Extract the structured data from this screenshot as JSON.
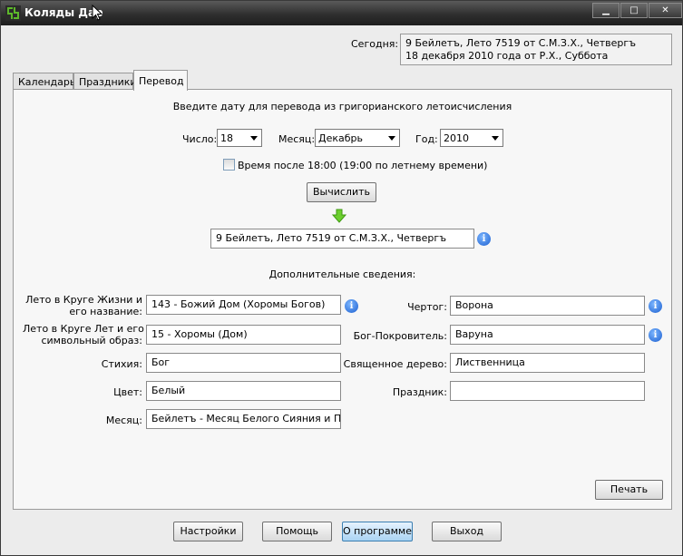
{
  "window": {
    "title": "Коляды Дар",
    "min_label": "▁",
    "max_label": "□",
    "close_label": "✕"
  },
  "today": {
    "label": "Сегодня:",
    "line1": "9 Бейлетъ, Лето 7519 от С.М.З.Х., Четвергъ",
    "line2": "18 декабря 2010 года от Р.Х., Суббота"
  },
  "tabs": [
    {
      "label": "Календарь"
    },
    {
      "label": "Праздники"
    },
    {
      "label": "Перевод",
      "active": true
    }
  ],
  "converter": {
    "instruction": "Введите дату для перевода из григорианского летоисчисления",
    "day_label": "Число:",
    "day_value": "18",
    "month_label": "Месяц:",
    "month_value": "Декабрь",
    "year_label": "Год:",
    "year_value": "2010",
    "checkbox_label": "Время после 18:00 (19:00 по летнему времени)",
    "checkbox_checked": false,
    "compute_button": "Вычислить",
    "result": "9 Бейлетъ, Лето 7519 от С.М.З.Х., Четвергъ"
  },
  "details": {
    "heading": "Дополнительные сведения:",
    "info_glyph": "i",
    "circle_of_life_label_1": "Лето в Круге Жизни и",
    "circle_of_life_label_2": "его название:",
    "circle_of_life_value": "143 - Божий Дом (Хоромы Богов)",
    "circle_of_years_label_1": "Лето в Круге Лет и его",
    "circle_of_years_label_2": "символьный образ:",
    "circle_of_years_value": "15 - Хоромы (Дом)",
    "element_label": "Стихия:",
    "element_value": "Бог",
    "color_label": "Цвет:",
    "color_value": "Белый",
    "month_label": "Месяц:",
    "month_value": "Бейлетъ - Месяц Белого Сияния и Покоя",
    "chertog_label": "Чертог:",
    "chertog_value": "Ворона",
    "patron_label": "Бог-Покровитель:",
    "patron_value": "Варуна",
    "tree_label": "Священное дерево:",
    "tree_value": "Лиственница",
    "holiday_label": "Праздник:",
    "holiday_value": ""
  },
  "print_button": "Печать",
  "footer": {
    "settings": "Настройки",
    "help": "Помощь",
    "about": "О программе",
    "exit": "Выход"
  },
  "colors": {
    "titlebar": "#2f2f2f",
    "accent_green": "#5db82a",
    "info_blue": "#1c5fd0"
  }
}
